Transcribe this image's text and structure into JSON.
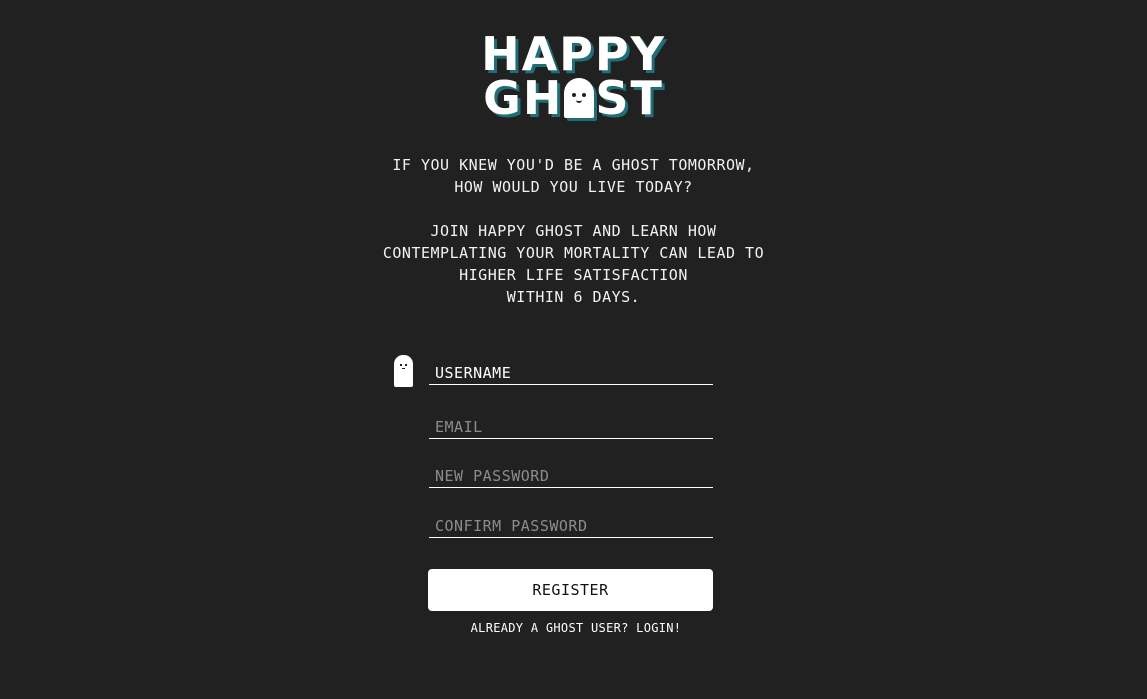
{
  "logo": {
    "line1": "HAPPY",
    "line2_before": "GH",
    "line2_after": "ST"
  },
  "tagline": {
    "question_line1": "IF YOU KNEW YOU'D BE A GHOST TOMORROW,",
    "question_line2": "HOW WOULD YOU LIVE TODAY?",
    "pitch_line1": "JOIN HAPPY GHOST AND LEARN HOW",
    "pitch_line2": "CONTEMPLATING YOUR MORTALITY CAN LEAD TO",
    "pitch_line3": "HIGHER LIFE SATISFACTION",
    "pitch_line4": "WITHIN 6 DAYS."
  },
  "form": {
    "username_placeholder": "USERNAME",
    "email_placeholder": "EMAIL",
    "new_password_placeholder": "NEW PASSWORD",
    "confirm_password_placeholder": "CONFIRM PASSWORD",
    "register_label": "REGISTER",
    "login_link": "ALREADY A GHOST USER? LOGIN!"
  },
  "colors": {
    "background": "#212121",
    "text": "#ffffff",
    "logo_shadow": "#1f6f78",
    "placeholder": "#8c8c8c"
  },
  "icons": {
    "logo_o": "ghost-icon",
    "field_cursor": "ghost-icon"
  }
}
